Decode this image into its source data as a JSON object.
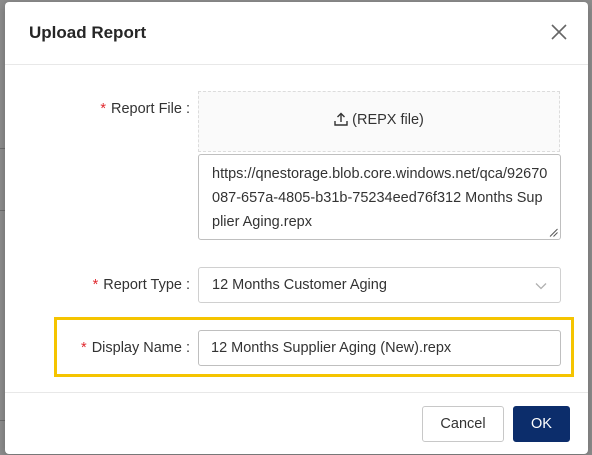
{
  "dialog": {
    "title": "Upload Report"
  },
  "form": {
    "report_file": {
      "label": "Report File :",
      "upload_label": "(REPX file)",
      "path_value": "https://qnestorage.blob.core.windows.net/qca/92670087-657a-4805-b31b-75234eed76f312 Months Supplier Aging.repx"
    },
    "report_type": {
      "label": "Report Type :",
      "selected": "12 Months Customer Aging"
    },
    "display_name": {
      "label": "Display Name :",
      "value": "12 Months Supplier Aging (New).repx"
    },
    "required_marker": "*"
  },
  "footer": {
    "cancel_label": "Cancel",
    "ok_label": "OK"
  },
  "colors": {
    "required": "#e0282e",
    "primary": "#0c2d6b",
    "highlight": "#f5c400"
  },
  "icons": {
    "close": "close-icon",
    "upload": "upload-icon",
    "dropdown": "chevron-down-icon"
  }
}
